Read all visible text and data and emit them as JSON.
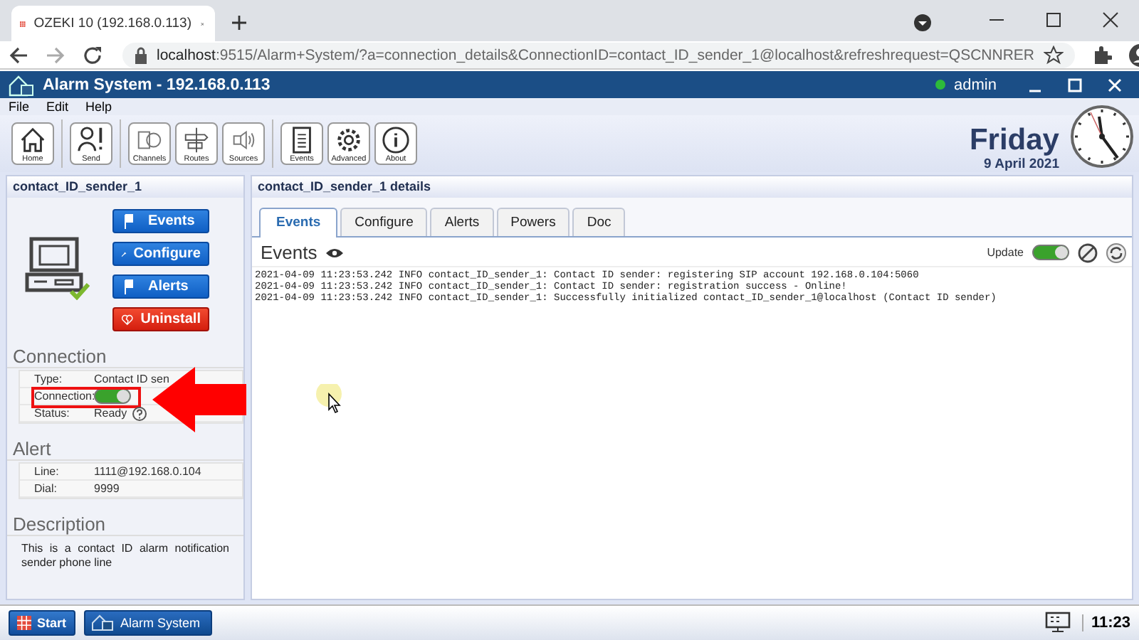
{
  "browser": {
    "tab_title": "OZEKI 10 (192.168.0.113)",
    "url_host": "localhost",
    "url_rest": ":9515/Alarm+System/?a=connection_details&ConnectionID=contact_ID_sender_1@localhost&refreshrequest=QSCNNRER"
  },
  "window": {
    "title": "Alarm System - 192.168.0.113",
    "user": "admin"
  },
  "menu": [
    "File",
    "Edit",
    "Help"
  ],
  "toolbar": [
    [
      {
        "label": "Home",
        "kind": "home"
      }
    ],
    [
      {
        "label": "Send",
        "kind": "send"
      }
    ],
    [
      {
        "label": "Channels",
        "kind": "channels"
      },
      {
        "label": "Routes",
        "kind": "routes"
      },
      {
        "label": "Sources",
        "kind": "sources"
      }
    ],
    [
      {
        "label": "Events",
        "kind": "events"
      },
      {
        "label": "Advanced",
        "kind": "advanced"
      },
      {
        "label": "About",
        "kind": "about"
      }
    ]
  ],
  "date": {
    "day": "Friday",
    "date": "9 April 2021"
  },
  "left_panel": {
    "title": "contact_ID_sender_1",
    "actions": [
      {
        "label": "Events",
        "kind": "events"
      },
      {
        "label": "Configure",
        "kind": "configure"
      },
      {
        "label": "Alerts",
        "kind": "alerts"
      },
      {
        "label": "Uninstall",
        "kind": "uninstall"
      }
    ],
    "connection": {
      "heading": "Connection",
      "type_label": "Type:",
      "type_value": "Contact ID sen",
      "connection_label": "Connection:",
      "connection_on": true,
      "status_label": "Status:",
      "status_value": "Ready"
    },
    "alert": {
      "heading": "Alert",
      "rows": [
        {
          "label": "Line:",
          "value": "1111@192.168.0.104"
        },
        {
          "label": "Dial:",
          "value": "9999"
        }
      ]
    },
    "description": {
      "heading": "Description",
      "text": "This is a contact ID alarm notification sender phone line"
    }
  },
  "details": {
    "title": "contact_ID_sender_1 details",
    "tabs": [
      {
        "label": "Events",
        "selected": true
      },
      {
        "label": "Configure",
        "selected": false
      },
      {
        "label": "Alerts",
        "selected": false
      },
      {
        "label": "Powers",
        "selected": false
      },
      {
        "label": "Doc",
        "selected": false
      }
    ],
    "heading": "Events",
    "update_label": "Update",
    "update_on": true,
    "log": [
      "2021-04-09 11:23:53.242 INFO contact_ID_sender_1: Contact ID sender: registering SIP account 192.168.0.104:5060",
      "2021-04-09 11:23:53.242 INFO contact_ID_sender_1: Contact ID sender: registration success - Online!",
      "2021-04-09 11:23:53.242 INFO contact_ID_sender_1: Successfully initialized contact_ID_sender_1@localhost (Contact ID sender)"
    ]
  },
  "taskbar": {
    "start": "Start",
    "app": "Alarm System",
    "time": "11:23"
  }
}
